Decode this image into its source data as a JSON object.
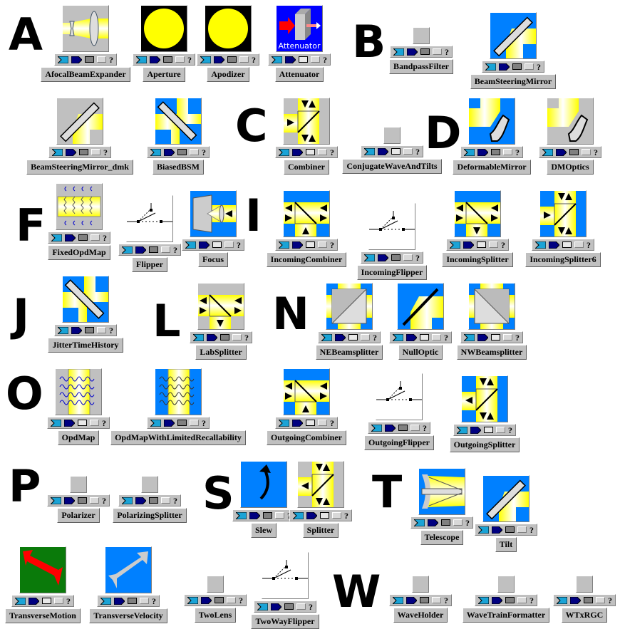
{
  "port_legend": {
    "question": "?"
  },
  "letters": [
    "A",
    "B",
    "C",
    "D",
    "F",
    "I",
    "J",
    "L",
    "N",
    "O",
    "P",
    "S",
    "T",
    "W"
  ],
  "components": [
    {
      "name": "AfocalBeamExpander",
      "icon": "afocal-beam-expander-icon",
      "state": "dark"
    },
    {
      "name": "Aperture",
      "icon": "aperture-icon",
      "state": "dark"
    },
    {
      "name": "Apodizer",
      "icon": "apodizer-icon",
      "state": "dark"
    },
    {
      "name": "Attenuator",
      "icon": "attenuator-icon",
      "state": "light",
      "icon_text": "Attenuator"
    },
    {
      "name": "BandpassFilter",
      "icon": "blank-icon",
      "state": "dark"
    },
    {
      "name": "BeamSteeringMirror",
      "icon": "beam-steering-mirror-icon",
      "state": "dark"
    },
    {
      "name": "BeamSteeringMirror_dmk",
      "icon": "beam-steering-mirror-icon",
      "state": "dark"
    },
    {
      "name": "BiasedBSM",
      "icon": "biased-bsm-icon",
      "state": "dark"
    },
    {
      "name": "Combiner",
      "icon": "combiner-icon",
      "state": "light"
    },
    {
      "name": "ConjugateWaveAndTilts",
      "icon": "blank-icon",
      "state": "light"
    },
    {
      "name": "DeformableMirror",
      "icon": "deformable-mirror-icon",
      "state": "dark"
    },
    {
      "name": "DMOptics",
      "icon": "deformable-mirror-icon",
      "state": "dark"
    },
    {
      "name": "FixedOpdMap",
      "icon": "opd-map-icon",
      "state": "dark"
    },
    {
      "name": "Flipper",
      "icon": "flipper-icon",
      "state": "dark"
    },
    {
      "name": "Focus",
      "icon": "focus-icon",
      "state": "light"
    },
    {
      "name": "IncomingCombiner",
      "icon": "splitter-icon",
      "state": "light"
    },
    {
      "name": "IncomingFlipper",
      "icon": "flipper-icon",
      "state": "dark"
    },
    {
      "name": "IncomingSplitter",
      "icon": "splitter-icon",
      "state": "light"
    },
    {
      "name": "IncomingSplitter6",
      "icon": "combiner-icon",
      "state": "light"
    },
    {
      "name": "JitterTimeHistory",
      "icon": "biased-bsm-icon",
      "state": "dark"
    },
    {
      "name": "LabSplitter",
      "icon": "splitter-icon",
      "state": "dark"
    },
    {
      "name": "NEBeamsplitter",
      "icon": "beamsplitter-cube-icon",
      "state": "light"
    },
    {
      "name": "NullOptic",
      "icon": "null-optic-icon",
      "state": "light"
    },
    {
      "name": "NWBeamsplitter",
      "icon": "beamsplitter-cube-icon",
      "state": "light"
    },
    {
      "name": "OpdMap",
      "icon": "opd-map-icon",
      "state": "light"
    },
    {
      "name": "OpdMapWithLimitedRecallability",
      "icon": "opd-map-icon",
      "state": "dark"
    },
    {
      "name": "OutgoingCombiner",
      "icon": "splitter-icon",
      "state": "light"
    },
    {
      "name": "OutgoingFlipper",
      "icon": "flipper-icon",
      "state": "dark"
    },
    {
      "name": "OutgoingSplitter",
      "icon": "combiner-icon",
      "state": "light"
    },
    {
      "name": "Polarizer",
      "icon": "blank-icon",
      "state": "dark"
    },
    {
      "name": "PolarizingSplitter",
      "icon": "blank-icon",
      "state": "dark"
    },
    {
      "name": "Slew",
      "icon": "slew-icon",
      "state": "dark"
    },
    {
      "name": "Splitter",
      "icon": "combiner-icon",
      "state": "light"
    },
    {
      "name": "Telescope",
      "icon": "telescope-icon",
      "state": "dark"
    },
    {
      "name": "Tilt",
      "icon": "beam-steering-mirror-icon",
      "state": "dark"
    },
    {
      "name": "TransverseMotion",
      "icon": "transverse-motion-icon",
      "state": "light"
    },
    {
      "name": "TransverseVelocity",
      "icon": "transverse-velocity-icon",
      "state": "dark"
    },
    {
      "name": "TwoLens",
      "icon": "blank-icon",
      "state": "dark"
    },
    {
      "name": "TwoWayFlipper",
      "icon": "flipper-icon",
      "state": "dark"
    },
    {
      "name": "WaveHolder",
      "icon": "blank-icon",
      "state": "dark"
    },
    {
      "name": "WaveTrainFormatter",
      "icon": "blank-icon",
      "state": "dark"
    },
    {
      "name": "WTxRGC",
      "icon": "blank-icon",
      "state": "dark"
    }
  ],
  "colors": {
    "blue": "#0080ff",
    "yellow": "#ffff00",
    "gray": "#c0c0c0",
    "port_in": "#1aa3d6",
    "port_out": "#000080"
  }
}
